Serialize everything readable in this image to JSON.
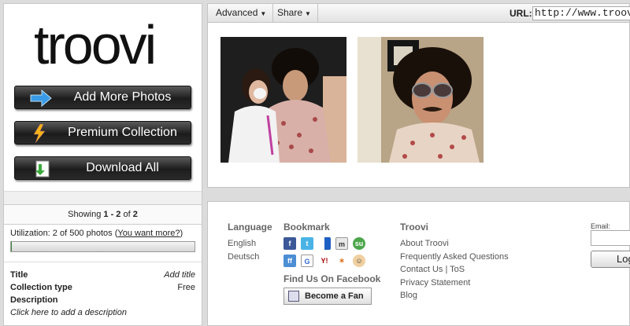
{
  "app": {
    "logo_text": "troovi"
  },
  "sidebar": {
    "buttons": {
      "add": "Add More Photos",
      "premium": "Premium Collection",
      "download": "Download All"
    },
    "showing": {
      "prefix": "Showing ",
      "range": "1 - 2",
      "middle": " of ",
      "total": "2"
    },
    "utilization": {
      "text": "Utilization: 2 of 500 photos",
      "link": "You want more?",
      "used": 2,
      "limit": 500
    },
    "meta": {
      "title_label": "Title",
      "title_value": "Add title",
      "type_label": "Collection type",
      "type_value": "Free",
      "desc_label": "Description",
      "desc_link": "Click here to add a description"
    }
  },
  "toolbar": {
    "advanced": "Advanced",
    "share": "Share",
    "url_label": "URL:",
    "url_value": "http://www.troovi"
  },
  "footer": {
    "language": {
      "heading": "Language",
      "items": [
        "English",
        "Deutsch"
      ]
    },
    "bookmark": {
      "heading": "Bookmark",
      "icons": [
        "facebook-icon",
        "twitter-icon",
        "delicious-icon",
        "myspace-icon",
        "stumbleupon-icon",
        "friendfeed-icon",
        "google-icon",
        "yahoo-icon",
        "digg-icon",
        "buzz-icon"
      ],
      "facebook_heading": "Find Us On Facebook",
      "fan_button": "Become a Fan"
    },
    "troovi": {
      "heading": "Troovi",
      "links": [
        "About Troovi",
        "Frequently Asked Questions",
        "Contact Us | ToS",
        "Privacy Statement",
        "Blog"
      ]
    },
    "login": {
      "email_label": "Email:",
      "button": "Log"
    }
  }
}
